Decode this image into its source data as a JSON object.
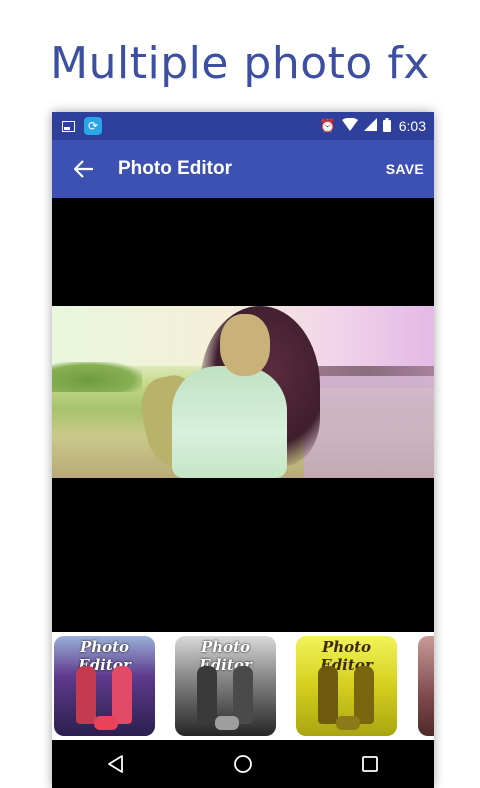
{
  "promo": {
    "headline": "Multiple photo fx"
  },
  "status_bar": {
    "time": "6:03",
    "left_icons": [
      "image-notification-icon",
      "app-notification-icon"
    ],
    "right_icons": [
      "alarm-icon",
      "wifi-icon",
      "signal-icon",
      "battery-icon"
    ]
  },
  "app_bar": {
    "title": "Photo Editor",
    "save_label": "SAVE",
    "back_icon": "arrow-left-icon",
    "background_color": "#3d51b3",
    "status_color": "#2f3f9c"
  },
  "filters": {
    "items": [
      {
        "label": "Photo Editor",
        "style": "color-pop"
      },
      {
        "label": "Photo Editor",
        "style": "monochrome"
      },
      {
        "label": "Photo Editor",
        "style": "yellow-tint"
      },
      {
        "label": "",
        "style": "sepia-red"
      }
    ]
  },
  "nav_bar": {
    "buttons": [
      "back-triangle-icon",
      "home-circle-icon",
      "recents-square-icon"
    ]
  }
}
